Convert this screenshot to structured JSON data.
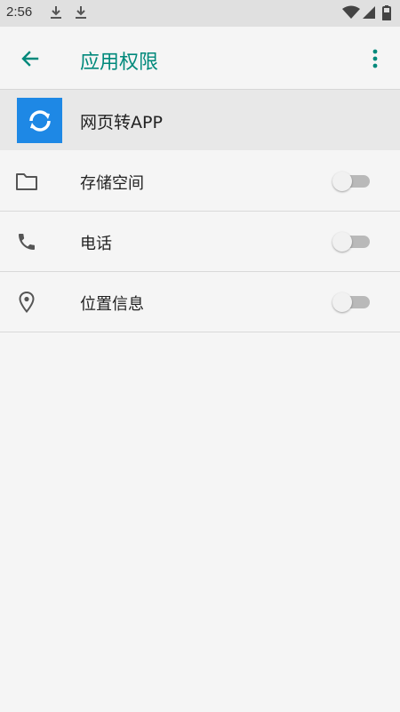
{
  "status_bar": {
    "time": "2:56",
    "icons": [
      "download-icon",
      "download-icon",
      "wifi-icon",
      "signal-icon",
      "battery-icon"
    ]
  },
  "toolbar": {
    "back_icon": "arrow-back-icon",
    "title": "应用权限",
    "overflow_icon": "more-vert-icon"
  },
  "app": {
    "name": "网页转APP",
    "icon": "sync-icon",
    "icon_color": "#1e88e5"
  },
  "permissions": [
    {
      "icon": "folder-icon",
      "label": "存储空间",
      "enabled": false
    },
    {
      "icon": "phone-icon",
      "label": "电话",
      "enabled": false
    },
    {
      "icon": "location-icon",
      "label": "位置信息",
      "enabled": false
    }
  ],
  "colors": {
    "accent": "#00897b",
    "background": "#f5f5f5",
    "status_bar": "#e0e0e0"
  }
}
